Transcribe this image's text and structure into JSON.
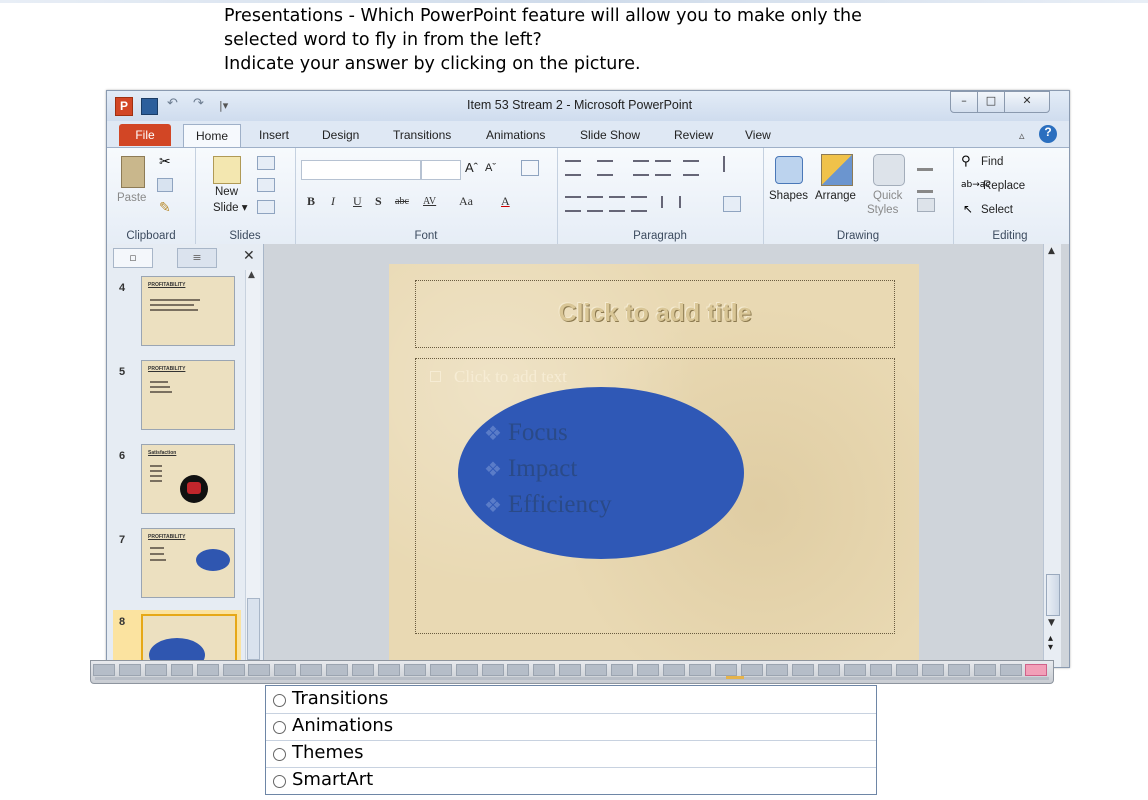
{
  "question": {
    "line1": "Presentations - Which PowerPoint feature will allow you to make only the",
    "line2": "selected word to fly in from the left?",
    "line3": "Indicate your answer by clicking on the picture."
  },
  "window": {
    "title": "Item 53 Stream 2 - Microsoft PowerPoint",
    "app_icon": "P",
    "controls": {
      "minimize": "–",
      "maximize": "□",
      "close": "✕"
    }
  },
  "tabs": {
    "file": "File",
    "items": [
      "Home",
      "Insert",
      "Design",
      "Transitions",
      "Animations",
      "Slide Show",
      "Review",
      "View"
    ],
    "active": "Home"
  },
  "ribbon": {
    "clipboard": {
      "group": "Clipboard",
      "paste": "Paste"
    },
    "slides": {
      "group": "Slides",
      "new_slide": "New",
      "new_slide2": "Slide ▾"
    },
    "font": {
      "group": "Font",
      "bold": "B",
      "italic": "I",
      "underline": "U",
      "shadow": "S",
      "strike": "abc",
      "spacing": "AV",
      "case": "Aa",
      "color": "A",
      "grow": "Aˆ",
      "shrink": "Aˇ"
    },
    "paragraph": {
      "group": "Paragraph"
    },
    "drawing": {
      "group": "Drawing",
      "shapes": "Shapes",
      "arrange": "Arrange",
      "quick": "Quick",
      "styles": "Styles"
    },
    "editing": {
      "group": "Editing",
      "find": "Find",
      "replace": "Replace",
      "select": "Select"
    }
  },
  "slide_panel": {
    "thumbnails": [
      {
        "num": "4",
        "title": "PROFITABILITY"
      },
      {
        "num": "5",
        "title": "PROFITABILITY"
      },
      {
        "num": "6",
        "title": "Satisfaction"
      },
      {
        "num": "7",
        "title": "PROFITABILITY"
      },
      {
        "num": "8",
        "title": ""
      }
    ]
  },
  "slide": {
    "title_placeholder": "Click to add title",
    "body_placeholder": "Click to add text",
    "bullets": [
      "Focus",
      "Impact",
      "Efficiency"
    ],
    "bullet_symbol": "❖",
    "colors": {
      "background": "#e9d9b3",
      "ellipse": "#2f58b6"
    }
  },
  "strip": {
    "cell_count": 37,
    "active_index": 36
  },
  "answers": {
    "options": [
      "Transitions",
      "Animations",
      "Themes",
      "SmartArt"
    ]
  }
}
